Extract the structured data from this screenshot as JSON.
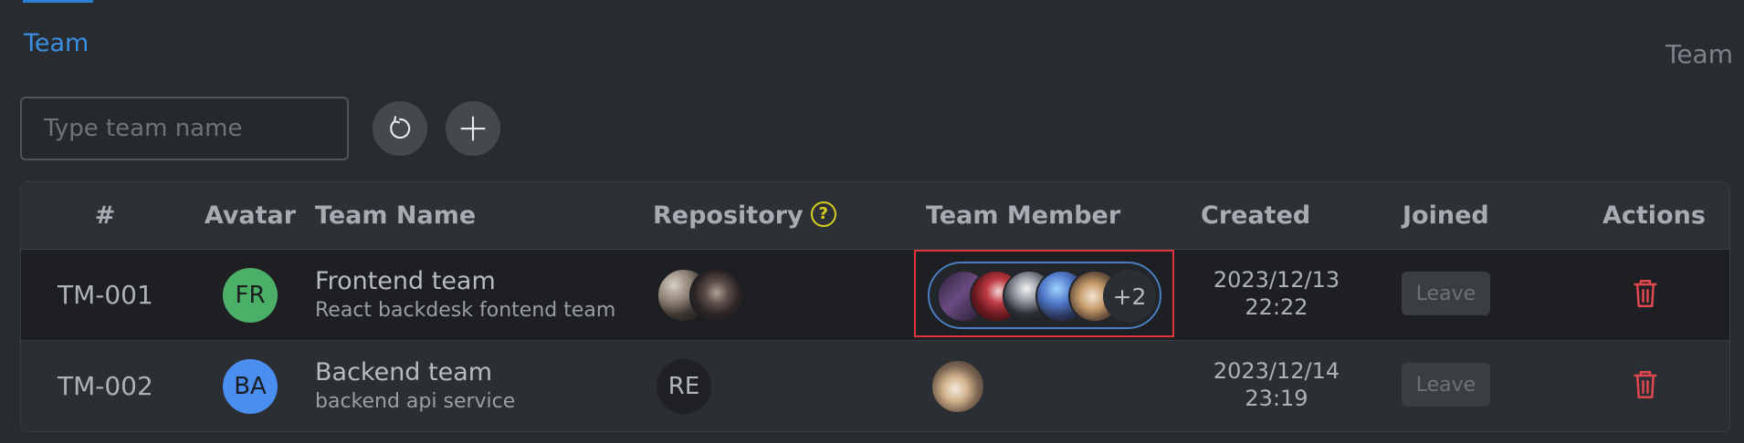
{
  "breadcrumb": "Team",
  "page_title": "Team",
  "search": {
    "placeholder": "Type team name"
  },
  "toolbar": {
    "refresh_icon": "refresh-icon",
    "add_icon": "plus-icon"
  },
  "table": {
    "columns": [
      "#",
      "Avatar",
      "Team Name",
      "Repository",
      "Team Member",
      "Created",
      "Joined",
      "Actions"
    ],
    "rows": [
      {
        "id": "TM-001",
        "avatar_initials": "FR",
        "avatar_color": "#4caf68",
        "name": "Frontend team",
        "description": "React backdesk fontend team",
        "repository": {
          "type": "images",
          "count": 2
        },
        "members": {
          "visible": 5,
          "more": "+2"
        },
        "created_date": "2023/12/13",
        "created_time": "22:22",
        "joined_action": "Leave"
      },
      {
        "id": "TM-002",
        "avatar_initials": "BA",
        "avatar_color": "#4a8ff0",
        "name": "Backend team",
        "description": "backend api service",
        "repository": {
          "type": "initials",
          "text": "RE"
        },
        "members": {
          "visible": 1
        },
        "created_date": "2023/12/14",
        "created_time": "23:19",
        "joined_action": "Leave"
      }
    ]
  },
  "colors": {
    "accent": "#2b7fd4",
    "delete": "#e0484f",
    "help": "#d8cf1f",
    "highlight": "#e0353f"
  }
}
